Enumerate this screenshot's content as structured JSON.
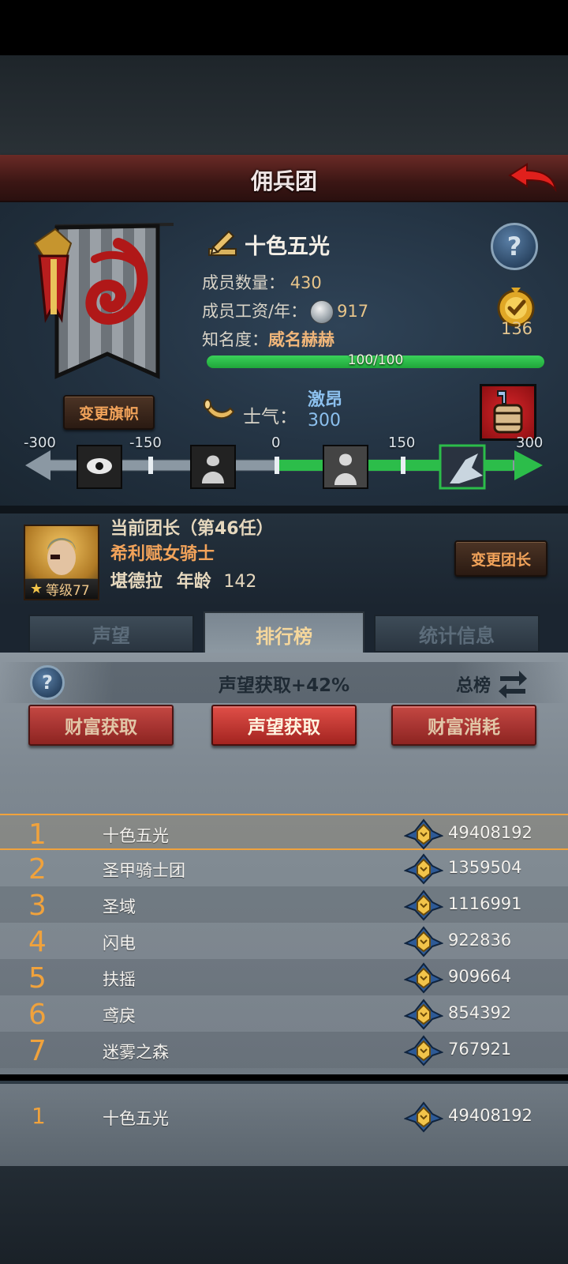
{
  "header": {
    "title": "佣兵团"
  },
  "guild": {
    "name": "十色五光",
    "members_label": "成员数量：",
    "members_value": "430",
    "wage_label": "成员工资/年：",
    "wage_value": "917",
    "fame_label": "知名度：",
    "fame_value": "威名赫赫",
    "fame_progress_text": "100/100",
    "fame_progress": 1.0,
    "medal_value": "136",
    "change_banner_label": "变更旗帜"
  },
  "morale": {
    "label": "士气：",
    "state": "激昂",
    "value": "300",
    "scale_ticks": [
      "-300",
      "-150",
      "0",
      "150",
      "300"
    ],
    "current": 300
  },
  "leader": {
    "title": "当前团长（第46任）",
    "class": "希利赋女骑士",
    "name": "堪德拉",
    "age_label": "年龄",
    "age_value": "142",
    "level_label": "等级77",
    "change_leader_label": "变更团长"
  },
  "tabs": [
    {
      "label": "声望",
      "active": false
    },
    {
      "label": "排行榜",
      "active": true
    },
    {
      "label": "统计信息",
      "active": false
    }
  ],
  "ranking": {
    "bonus_text": "声望获取+42%",
    "board_label": "总榜",
    "filters": [
      {
        "label": "财富获取",
        "active": false
      },
      {
        "label": "声望获取",
        "active": true
      },
      {
        "label": "财富消耗",
        "active": false
      }
    ],
    "rows": [
      {
        "rank": "1",
        "name": "十色五光",
        "score": "49408192"
      },
      {
        "rank": "2",
        "name": "圣甲骑士团",
        "score": "1359504"
      },
      {
        "rank": "3",
        "name": "圣域",
        "score": "1116991"
      },
      {
        "rank": "4",
        "name": "闪电",
        "score": "922836"
      },
      {
        "rank": "5",
        "name": "扶摇",
        "score": "909664"
      },
      {
        "rank": "6",
        "name": "鸢戾",
        "score": "854392"
      },
      {
        "rank": "7",
        "name": "迷雾之森",
        "score": "767921"
      }
    ],
    "my_row": {
      "rank": "1",
      "name": "十色五光",
      "score": "49408192"
    }
  },
  "colors": {
    "accent_orange": "#f0a23c",
    "fame_green": "#2bb547",
    "title_red": "#6a2a26",
    "morale_blue": "#8cc0ee"
  }
}
